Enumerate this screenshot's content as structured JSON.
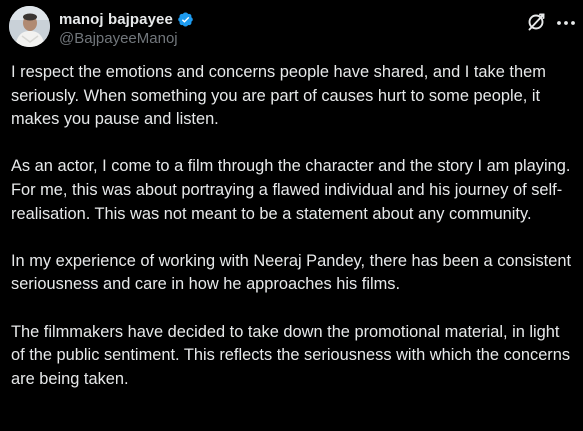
{
  "post": {
    "display_name": "manoj bajpayee",
    "handle": "@BajpayeeManoj",
    "verified": true,
    "paragraphs": [
      "I respect the emotions and concerns people have shared, and I take them seriously. When something you are part of causes hurt to some people, it makes you pause and listen.",
      "As an actor, I come to a film through the character and the story I am playing. For me, this was about portraying a flawed individual and his journey of self-realisation. This was not meant to be a statement about any community.",
      "In my experience of working with Neeraj Pandey, there has been a consistent seriousness and care in how he approaches his films.",
      "The filmmakers have decided to take down the promotional material, in light of the public sentiment. This reflects the seriousness with which the concerns are being taken."
    ]
  },
  "icons": {
    "avatar": "avatar",
    "verified": "verified-badge-icon",
    "grok": "grok-icon",
    "more": "more-icon"
  },
  "colors": {
    "background": "#000000",
    "text": "#e7e9ea",
    "secondary": "#71767b",
    "verified": "#1d9bf0"
  }
}
